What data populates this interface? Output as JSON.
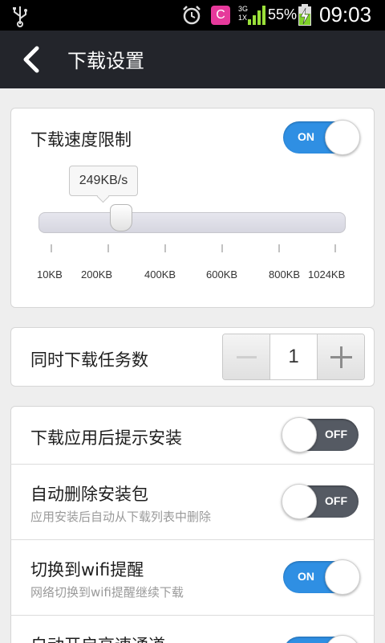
{
  "status_bar": {
    "battery_percent": "55%",
    "time": "09:03",
    "network_top": "3G",
    "network_bottom": "1X",
    "app_icon_letter": "C"
  },
  "header": {
    "title": "下载设置"
  },
  "speed_limit": {
    "label": "下载速度限制",
    "toggle": "ON",
    "tooltip": "249KB/s",
    "slider_value_kb": 249,
    "slider_min_kb": 10,
    "slider_max_kb": 1024,
    "tick_labels": [
      "10KB",
      "200KB",
      "400KB",
      "600KB",
      "800KB",
      "1024KB"
    ]
  },
  "concurrent_tasks": {
    "label": "同时下载任务数",
    "value": "1"
  },
  "settings": [
    {
      "label": "下载应用后提示安装",
      "toggle": "OFF"
    },
    {
      "label": "自动删除安装包",
      "sub": "应用安装后自动从下载列表中删除",
      "toggle": "OFF"
    },
    {
      "label": "切换到wifi提醒",
      "sub": "网络切换到wifi提醒继续下载",
      "toggle": "ON"
    },
    {
      "label": "自动开启高速通道",
      "toggle": "ON"
    }
  ],
  "colors": {
    "header_bg": "#23252b",
    "toggle_on": "#2f8fe3",
    "toggle_off": "#555a63"
  }
}
